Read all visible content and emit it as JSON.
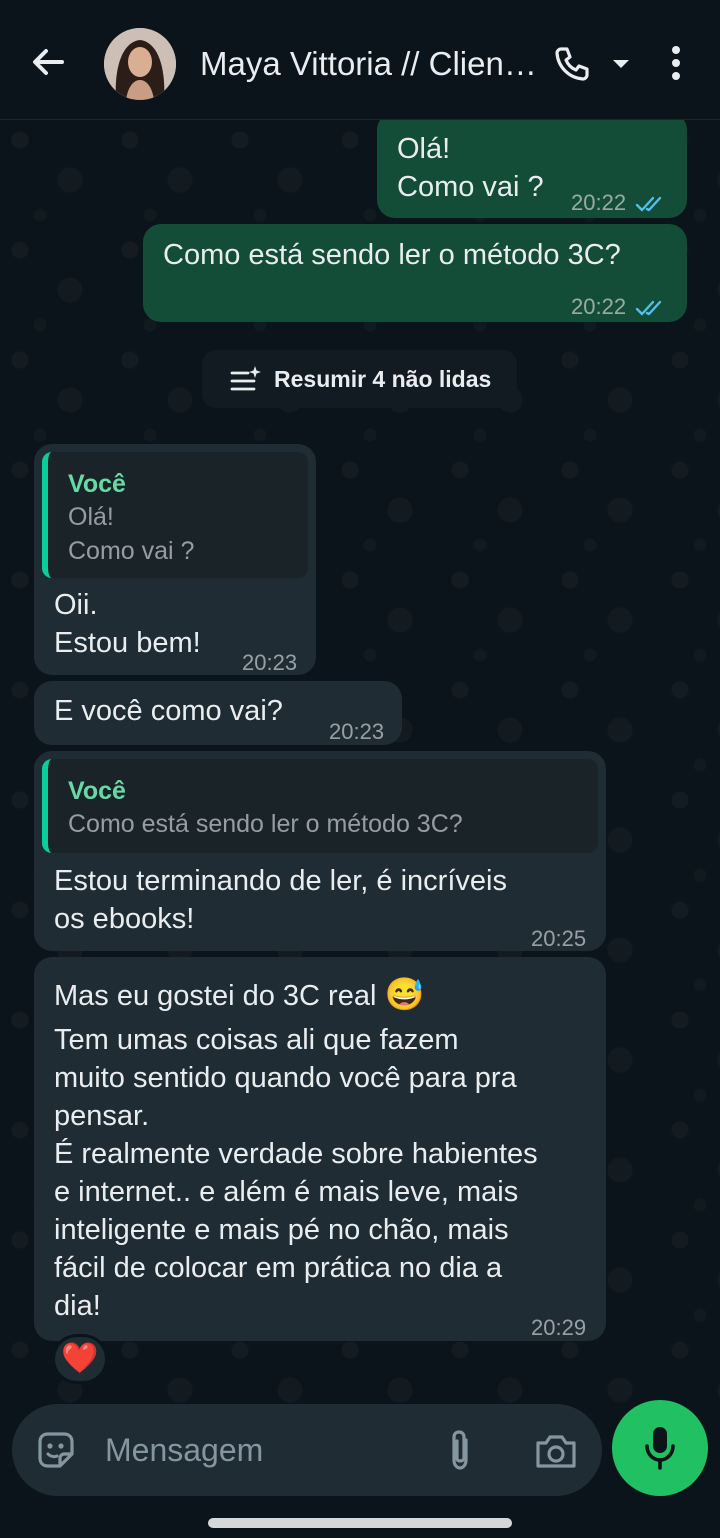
{
  "header": {
    "contact_name": "Maya Vittoria // Clien…",
    "icons": [
      "back-arrow-icon",
      "avatar",
      "phone-icon",
      "dropdown-caret-icon",
      "more-vert-icon"
    ]
  },
  "messages": {
    "out1": {
      "text": "Olá!\nComo vai ?",
      "time": "20:22",
      "status": "read"
    },
    "out2": {
      "text": "Como está sendo ler o método 3C?",
      "time": "20:22",
      "status": "read"
    },
    "in1": {
      "quote_author": "Você",
      "quote_text": "Olá!\nComo vai ?",
      "text": "Oii.\nEstou bem!",
      "time": "20:23"
    },
    "in2": {
      "text": "E você como vai?",
      "time": "20:23"
    },
    "in3": {
      "quote_author": "Você",
      "quote_text": "Como está sendo ler o método 3C?",
      "text": "Estou terminando de ler,  é incríveis\nos ebooks!",
      "time": "20:25"
    },
    "in4": {
      "line1": "Mas eu gostei do 3C real",
      "emoji": "😅",
      "text": "Tem umas coisas ali que fazem\nmuito sentido quando você para pra\npensar.\nÉ realmente verdade sobre habientes\ne internet.. e além é mais leve, mais\ninteligente e mais pé no chão, mais\nfácil de colocar em prática no dia a\ndia!",
      "time": "20:29",
      "reaction": "❤️"
    }
  },
  "summary_chip": {
    "label": "Resumir 4 não lidas"
  },
  "composer": {
    "placeholder": "Mensagem"
  },
  "colors": {
    "background": "#0b141a",
    "outgoing_bubble": "#144d37",
    "incoming_bubble": "#1f2c33",
    "read_ticks": "#53bdeb",
    "quote_accent": "#06cf9c",
    "mic_button": "#21c063"
  }
}
